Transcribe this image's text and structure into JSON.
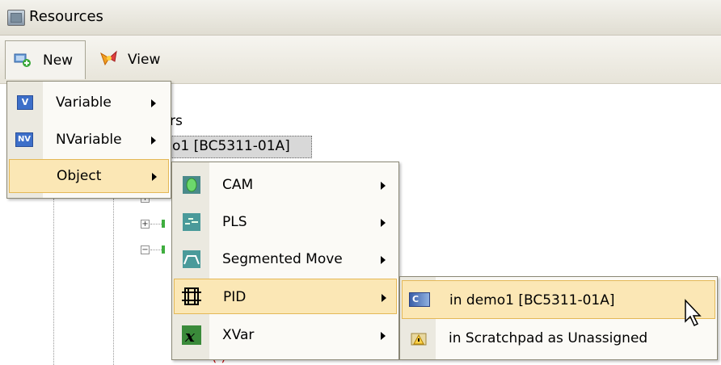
{
  "window": {
    "title": "Resources"
  },
  "toolbar": {
    "new_label": "New",
    "view_label": "View"
  },
  "tree": {
    "partial_label": "rs",
    "selected_node": "o1 [BC5311-01A]",
    "bottom_partial": "( )"
  },
  "new_menu": {
    "items": [
      {
        "label": "Variable",
        "icon": "variable-icon",
        "icon_text": "V"
      },
      {
        "label": "NVariable",
        "icon": "nvariable-icon",
        "icon_text": "NV"
      },
      {
        "label": "Object",
        "icon": "object-icon",
        "icon_text": ""
      }
    ]
  },
  "object_menu": {
    "items": [
      {
        "label": "CAM",
        "icon": "cam-icon"
      },
      {
        "label": "PLS",
        "icon": "pls-icon"
      },
      {
        "label": "Segmented Move",
        "icon": "segmented-move-icon"
      },
      {
        "label": "PID",
        "icon": "pid-icon"
      },
      {
        "label": "XVar",
        "icon": "xvar-icon"
      }
    ]
  },
  "pid_menu": {
    "items": [
      {
        "label": "in demo1 [BC5311-01A]",
        "icon": "controller-icon",
        "icon_text": "C"
      },
      {
        "label": "in Scratchpad as Unassigned",
        "icon": "scratchpad-icon"
      }
    ]
  },
  "colors": {
    "highlight": "#fbe7b5",
    "highlight_border": "#e4b857",
    "menu_bg": "#fbfaf6",
    "menu_gutter": "#ebe9e0"
  }
}
